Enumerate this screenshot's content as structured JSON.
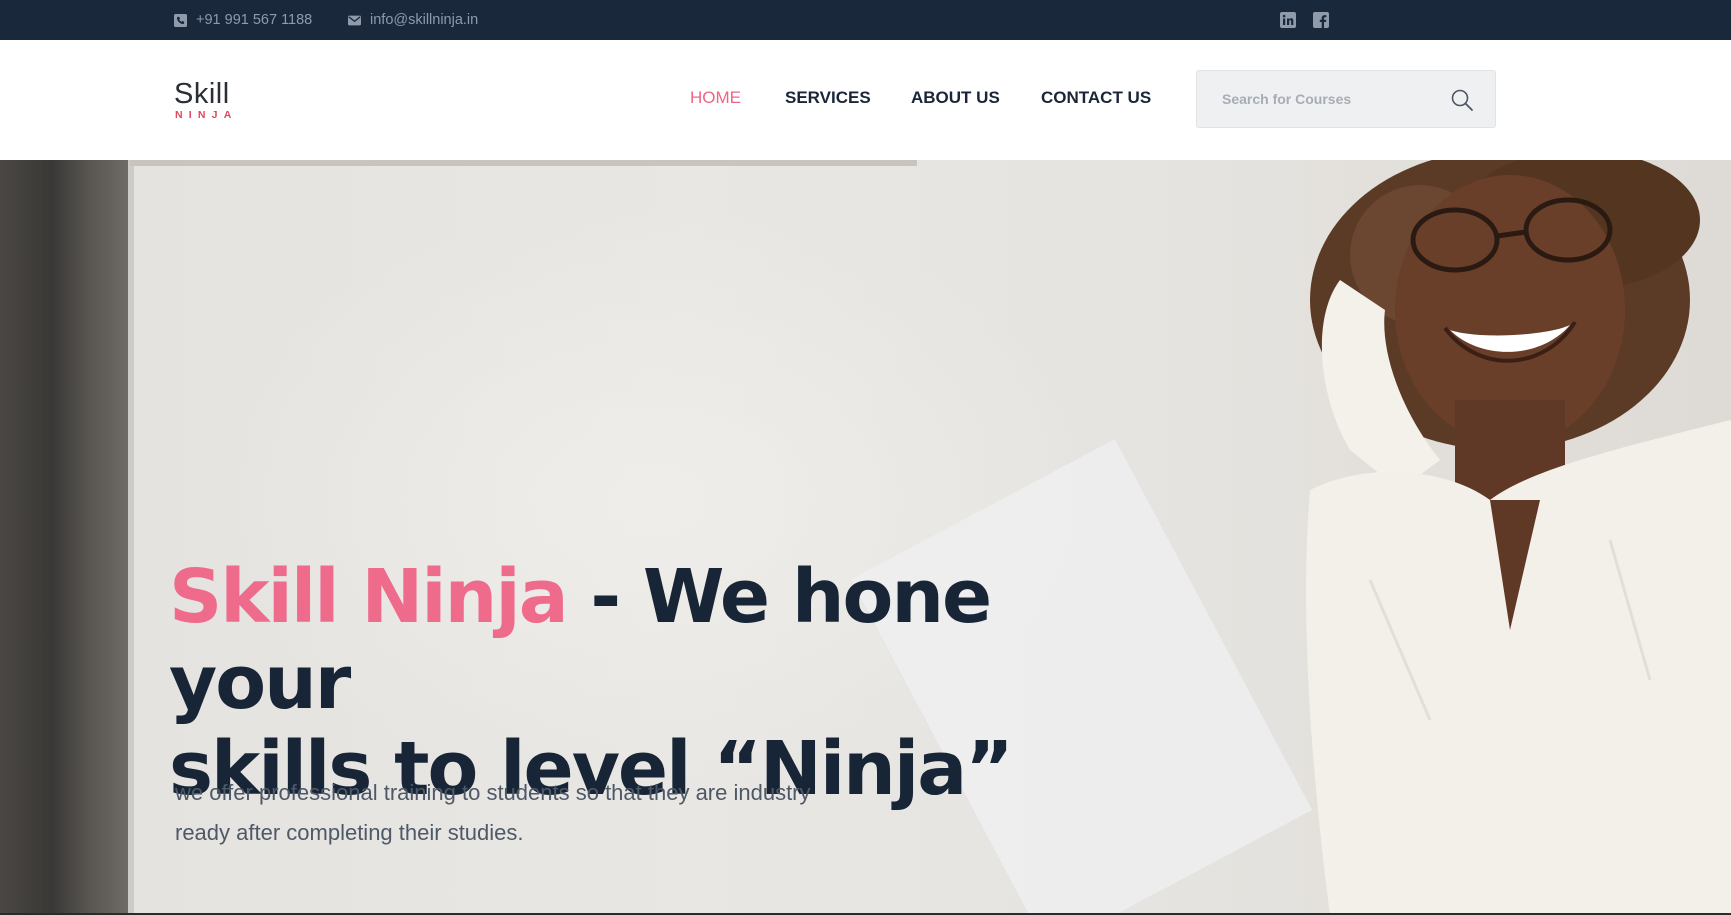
{
  "topbar": {
    "phone": "+91 991 567 1188",
    "email": "info@skillninja.in",
    "social_icons": [
      "linkedin-icon",
      "facebook-icon"
    ]
  },
  "header": {
    "logo": {
      "word": "Skill",
      "sub": "NINJA"
    },
    "nav": [
      {
        "label": "HOME",
        "active": true
      },
      {
        "label": "SERVICES",
        "active": false
      },
      {
        "label": "ABOUT US",
        "active": false
      },
      {
        "label": "CONTACT US",
        "active": false
      }
    ],
    "search": {
      "placeholder": "Search for Courses",
      "value": ""
    }
  },
  "hero": {
    "headline_brand": "Skill Ninja",
    "headline_rest_1": " - We hone your",
    "headline_rest_2": "skills to level “Ninja”",
    "subtext_line1": "we offer professional training to students so that they are industry",
    "subtext_line2": "ready after completing their studies."
  },
  "colors": {
    "topbar_bg": "#19283a",
    "accent_pink": "#ee6585",
    "heading_navy": "#172537",
    "muted_text": "#8f9bab"
  }
}
